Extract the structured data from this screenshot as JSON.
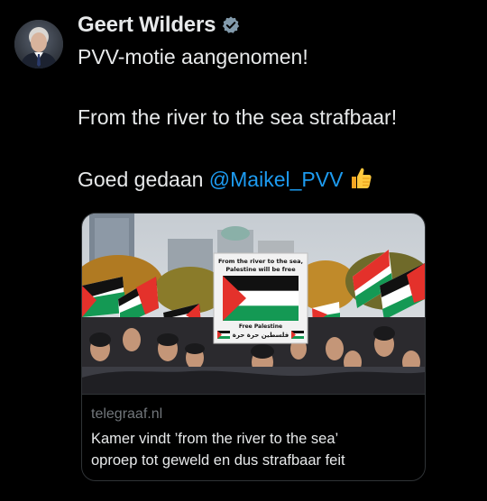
{
  "author": {
    "name": "Geert Wilders",
    "verified_icon": "verified-badge-icon"
  },
  "tweet": {
    "line1": "PVV-motie aangenomen!",
    "line2": "From the river to the sea strafbaar!",
    "line3_prefix": "Goed gedaan ",
    "mention": "@Maikel_PVV",
    "emoji": "thumbs-up-icon"
  },
  "link_card": {
    "domain": "telegraaf.nl",
    "title_line1": "Kamer vindt ’from the river to the sea’",
    "title_line2": "oproep tot geweld en dus strafbaar feit",
    "sign_line1": "From the river to the sea,",
    "sign_line2": "Palestine will be free",
    "sign_line3": "Free Palestine",
    "sign_line4": "فلسطين حرة حرة"
  },
  "colors": {
    "background": "#000000",
    "text": "#e7e9ea",
    "mention": "#1d9bf0",
    "secondary": "#71767b",
    "border": "#2f3336"
  }
}
